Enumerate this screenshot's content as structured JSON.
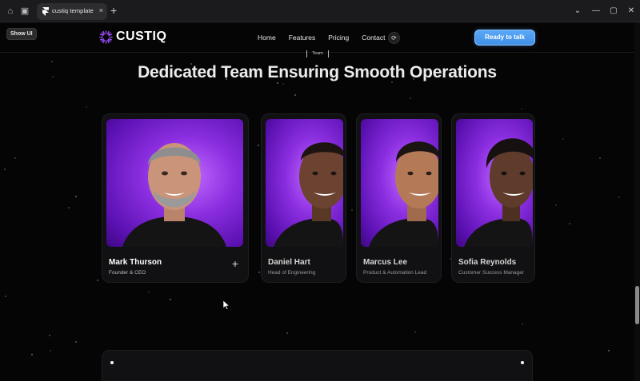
{
  "browser": {
    "tab_title": "custiq template",
    "tab_close": "×",
    "new_tab": "+",
    "controls": {
      "minimize": "—",
      "maximize": "▢",
      "close": "✕",
      "dropdown": "⌄"
    }
  },
  "overlay": {
    "show_ui_label": "Show UI"
  },
  "nav": {
    "brand": "CUSTIQ",
    "items": [
      "Home",
      "Features",
      "Pricing",
      "Contact"
    ],
    "refresh_icon": "⟳",
    "cta_label": "Ready to talk"
  },
  "section": {
    "tag": "Team",
    "heading": "Dedicated Team Ensuring Smooth Operations"
  },
  "team": [
    {
      "name": "Mark Thurson",
      "role": "Founder & CEO",
      "action": "+"
    },
    {
      "name": "Daniel Hart",
      "role": "Head of Engineering"
    },
    {
      "name": "Marcus Lee",
      "role": "Product & Automation Lead"
    },
    {
      "name": "Sofia Reynolds",
      "role": "Customer Success Manager"
    }
  ],
  "colors": {
    "accent": "#4a9af0",
    "brand_purple": "#8a2ee0",
    "background": "#050505"
  }
}
